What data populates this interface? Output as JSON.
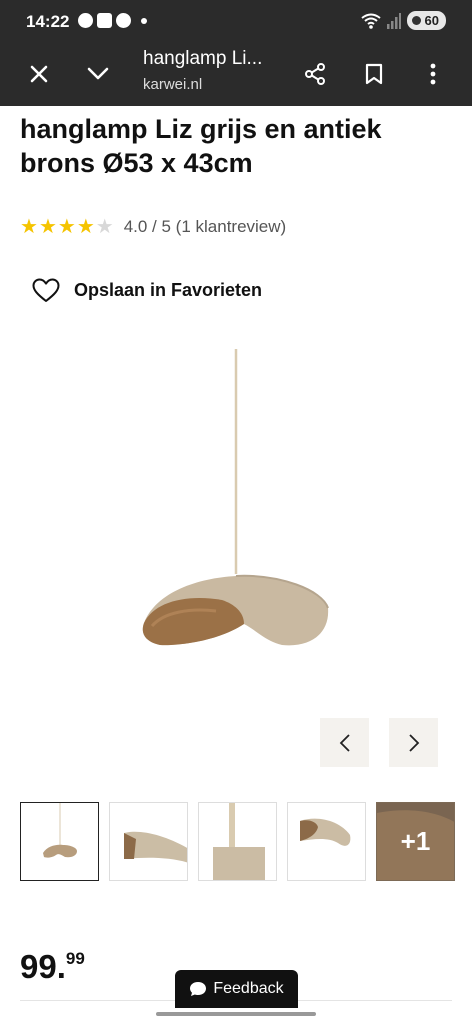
{
  "status_bar": {
    "time": "14:22",
    "battery": "60"
  },
  "toolbar": {
    "title": "hanglamp Li...",
    "url": "karwei.nl"
  },
  "product": {
    "title": "hanglamp Liz grijs en antiek brons Ø53 x 43cm",
    "rating": {
      "stars_filled": 4,
      "stars_total": 5,
      "text": "4.0 / 5 (1 klantreview)"
    },
    "favorite_label": "Opslaan in Favorieten",
    "price_int": "99.",
    "price_dec": "99"
  },
  "gallery": {
    "more_label": "+1"
  },
  "feedback": {
    "label": "Feedback"
  }
}
